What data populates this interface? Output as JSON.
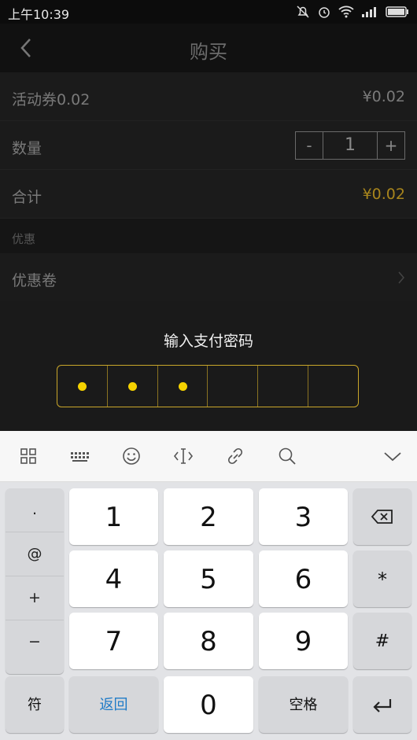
{
  "status": {
    "time": "上午10:39"
  },
  "nav": {
    "title": "购买"
  },
  "rows": {
    "voucher_label": "活动券0.02",
    "voucher_price": "¥0.02",
    "qty_label": "数量",
    "qty_minus": "-",
    "qty_value": "1",
    "qty_plus": "+",
    "total_label": "合计",
    "total_value": "¥0.02"
  },
  "section": {
    "title": "优惠"
  },
  "coupon": {
    "label": "优惠卷"
  },
  "payment": {
    "title": "输入支付密码",
    "filled": 3,
    "length": 6
  },
  "colors": {
    "accent": "#f5d200",
    "total": "#a8851c"
  },
  "toolbar": {
    "icons": [
      "grid-icon",
      "keyboard-icon",
      "emoji-icon",
      "cursor-move-icon",
      "link-icon",
      "search-icon",
      "collapse-icon"
    ]
  },
  "keyboard": {
    "side": [
      ".",
      "@",
      "+",
      "−"
    ],
    "digits": [
      "1",
      "2",
      "3",
      "4",
      "5",
      "6",
      "7",
      "8",
      "9"
    ],
    "zero": "0",
    "star": "*",
    "hash": "#",
    "sym": "符",
    "back": "返回",
    "space": "空格"
  }
}
